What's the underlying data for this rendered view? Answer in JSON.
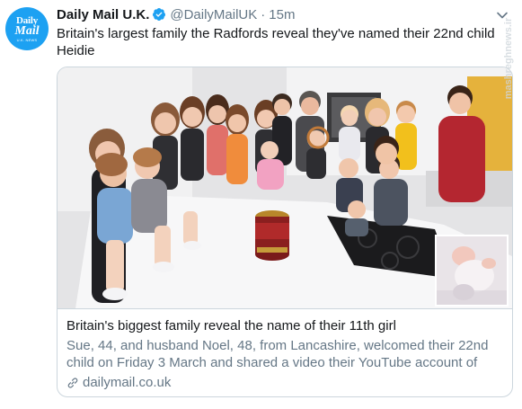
{
  "tweet": {
    "avatar": {
      "line1": "Daily",
      "line2": "Mail",
      "line3": "U.K. NEWS"
    },
    "author_name": "Daily Mail U.K.",
    "handle": "@DailyMailUK",
    "separator": "·",
    "time": "15m",
    "text": "Britain's largest family the Radfords reveal they've named their 22nd child Heidie",
    "verified_icon": "verified-badge-icon",
    "menu_icon": "chevron-down-icon"
  },
  "card": {
    "title": "Britain's biggest family reveal the name of their 11th girl",
    "description": "Sue, 44, and husband Noel, 48, from Lancashire, welcomed their 22nd child on Friday 3 March and shared a video their YouTube account of th...",
    "domain": "dailymail.co.uk",
    "link_icon": "link-icon"
  },
  "watermark": "mashreghnews.ir",
  "colors": {
    "accent": "#1da1f2",
    "text": "#14171a",
    "muted": "#657786",
    "border": "#ccd6dd"
  }
}
